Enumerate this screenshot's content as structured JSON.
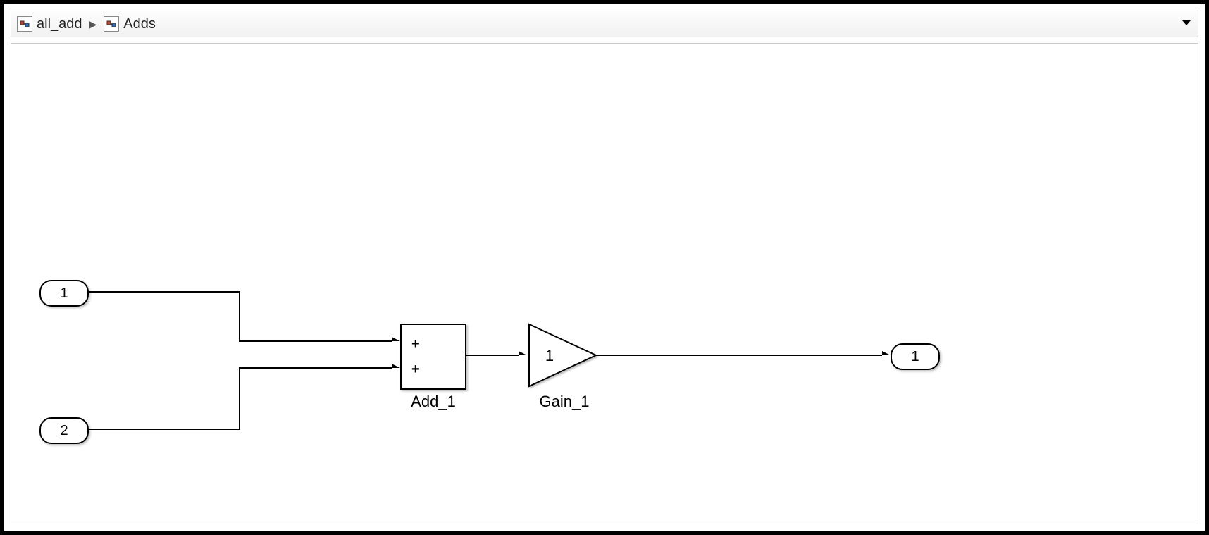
{
  "breadcrumb": {
    "root": "all_add",
    "current": "Adds"
  },
  "blocks": {
    "inport1": {
      "label": "1"
    },
    "inport2": {
      "label": "2"
    },
    "add": {
      "name": "Add_1",
      "sign1": "+",
      "sign2": "+"
    },
    "gain": {
      "name": "Gain_1",
      "value": "1"
    },
    "outport1": {
      "label": "1"
    }
  }
}
